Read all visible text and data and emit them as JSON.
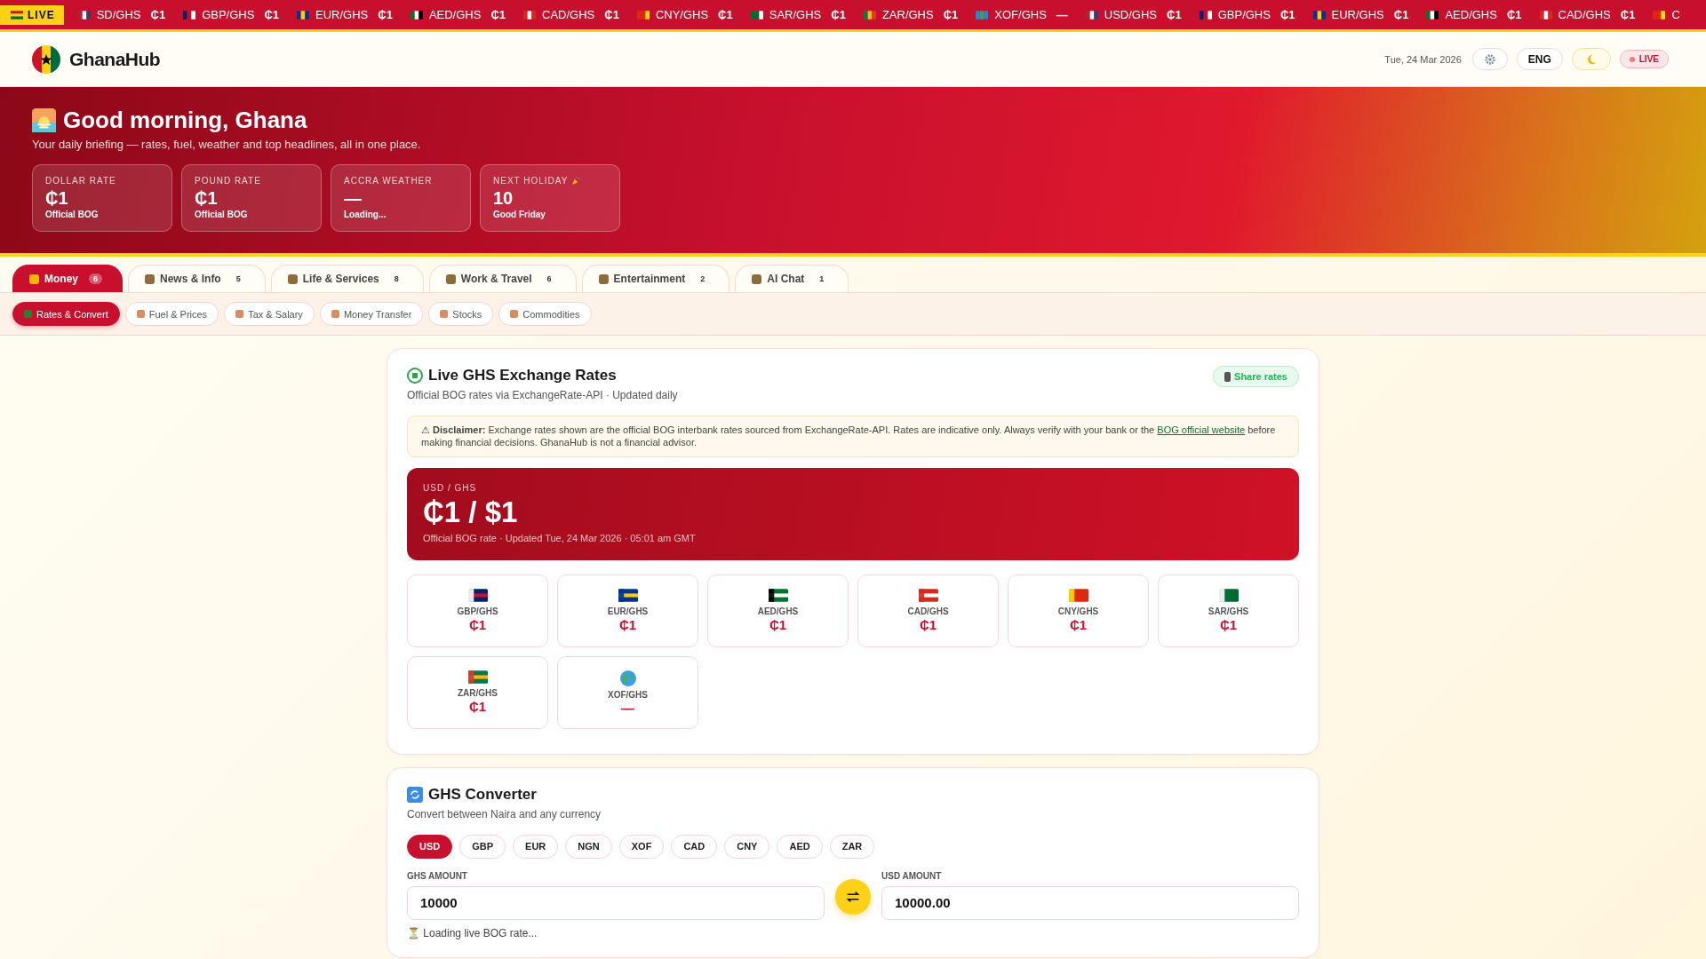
{
  "ticker": {
    "badge": "LIVE",
    "items": [
      {
        "pair": "SD/GHS",
        "rate": "₵1"
      },
      {
        "pair": "GBP/GHS",
        "rate": "₵1"
      },
      {
        "pair": "EUR/GHS",
        "rate": "₵1"
      },
      {
        "pair": "AED/GHS",
        "rate": "₵1"
      },
      {
        "pair": "CAD/GHS",
        "rate": "₵1"
      },
      {
        "pair": "CNY/GHS",
        "rate": "₵1"
      },
      {
        "pair": "SAR/GHS",
        "rate": "₵1"
      },
      {
        "pair": "ZAR/GHS",
        "rate": "₵1"
      },
      {
        "pair": "XOF/GHS",
        "rate": "—"
      },
      {
        "pair": "USD/GHS",
        "rate": "₵1"
      },
      {
        "pair": "GBP/GHS",
        "rate": "₵1"
      },
      {
        "pair": "EUR/GHS",
        "rate": "₵1"
      },
      {
        "pair": "AED/GHS",
        "rate": "₵1"
      },
      {
        "pair": "CAD/GHS",
        "rate": "₵1"
      },
      {
        "pair": "C"
      }
    ]
  },
  "header": {
    "brand_a": "Ghana",
    "brand_b": "Hub",
    "date": "Tue, 24 Mar 2026",
    "lang": "ENG",
    "live": "LIVE"
  },
  "hero": {
    "title": "Good morning, Ghana",
    "subtitle": "Your daily briefing — rates, fuel, weather and top headlines, all in one place.",
    "stats": [
      {
        "label": "DOLLAR RATE",
        "value": "₵1",
        "note": "Official BOG"
      },
      {
        "label": "POUND RATE",
        "value": "₵1",
        "note": "Official BOG"
      },
      {
        "label": "ACCRA WEATHER",
        "value": "—",
        "note": "Loading..."
      },
      {
        "label": "NEXT HOLIDAY",
        "value": "10",
        "note": "Good Friday"
      }
    ]
  },
  "tabs": [
    {
      "label": "Money",
      "count": "6",
      "selected": true
    },
    {
      "label": "News & Info",
      "count": "5",
      "selected": false
    },
    {
      "label": "Life & Services",
      "count": "8",
      "selected": false
    },
    {
      "label": "Work & Travel",
      "count": "6",
      "selected": false
    },
    {
      "label": "Entertainment",
      "count": "2",
      "selected": false
    },
    {
      "label": "AI Chat",
      "count": "1",
      "selected": false
    }
  ],
  "subtabs": [
    {
      "label": "Rates & Convert",
      "selected": true
    },
    {
      "label": "Fuel & Prices",
      "selected": false
    },
    {
      "label": "Tax & Salary",
      "selected": false
    },
    {
      "label": "Money Transfer",
      "selected": false
    },
    {
      "label": "Stocks",
      "selected": false
    },
    {
      "label": "Commodities",
      "selected": false
    }
  ],
  "rates": {
    "title": "Live GHS Exchange Rates",
    "subtitle": "Official BOG rates via ExchangeRate-API · Updated daily",
    "share": "Share rates",
    "disclaimer": {
      "text": "⚠ **Disclaimer:** Exchange rates shown are the official BOG interbank rates sourced from ExchangeRate-API. Rates are indicative only. Always verify with your bank or the",
      "link": "BOG official website",
      "tail": "before making financial decisions. GhanaHub is not a financial advisor."
    },
    "main": {
      "pair": "USD / GHS",
      "value": "₵1 / $1",
      "note": "Official BOG rate · Updated Tue, 24 Mar 2026 · 05:01 am GMT"
    },
    "tiles": [
      {
        "kind": "flag",
        "pair": "GBP/GHS",
        "value": "₵1"
      },
      {
        "kind": "flag",
        "pair": "EUR/GHS",
        "value": "₵1"
      },
      {
        "kind": "flag",
        "pair": "AED/GHS",
        "value": "₵1"
      },
      {
        "kind": "flag",
        "pair": "CAD/GHS",
        "value": "₵1"
      },
      {
        "kind": "flag",
        "pair": "CNY/GHS",
        "value": "₵1"
      },
      {
        "kind": "flag",
        "pair": "SAR/GHS",
        "value": "₵1"
      },
      {
        "kind": "flag",
        "pair": "ZAR/GHS",
        "value": "₵1"
      },
      {
        "kind": "globe",
        "pair": "XOF/GHS",
        "value": "—"
      }
    ]
  },
  "converter": {
    "title": "GHS Converter",
    "subtitle": "Convert between Naira and any currency",
    "currencies": [
      {
        "code": "USD",
        "selected": true
      },
      {
        "code": "GBP",
        "selected": false
      },
      {
        "code": "EUR",
        "selected": false
      },
      {
        "code": "NGN",
        "selected": false
      },
      {
        "code": "XOF",
        "selected": false
      },
      {
        "code": "CAD",
        "selected": false
      },
      {
        "code": "CNY",
        "selected": false
      },
      {
        "code": "AED",
        "selected": false
      },
      {
        "code": "ZAR",
        "selected": false
      }
    ],
    "from": {
      "label": "GHS AMOUNT",
      "value": "10000"
    },
    "to": {
      "label": "USD AMOUNT",
      "value": "10000.00"
    },
    "status": "⏳ Loading live BOG rate..."
  }
}
